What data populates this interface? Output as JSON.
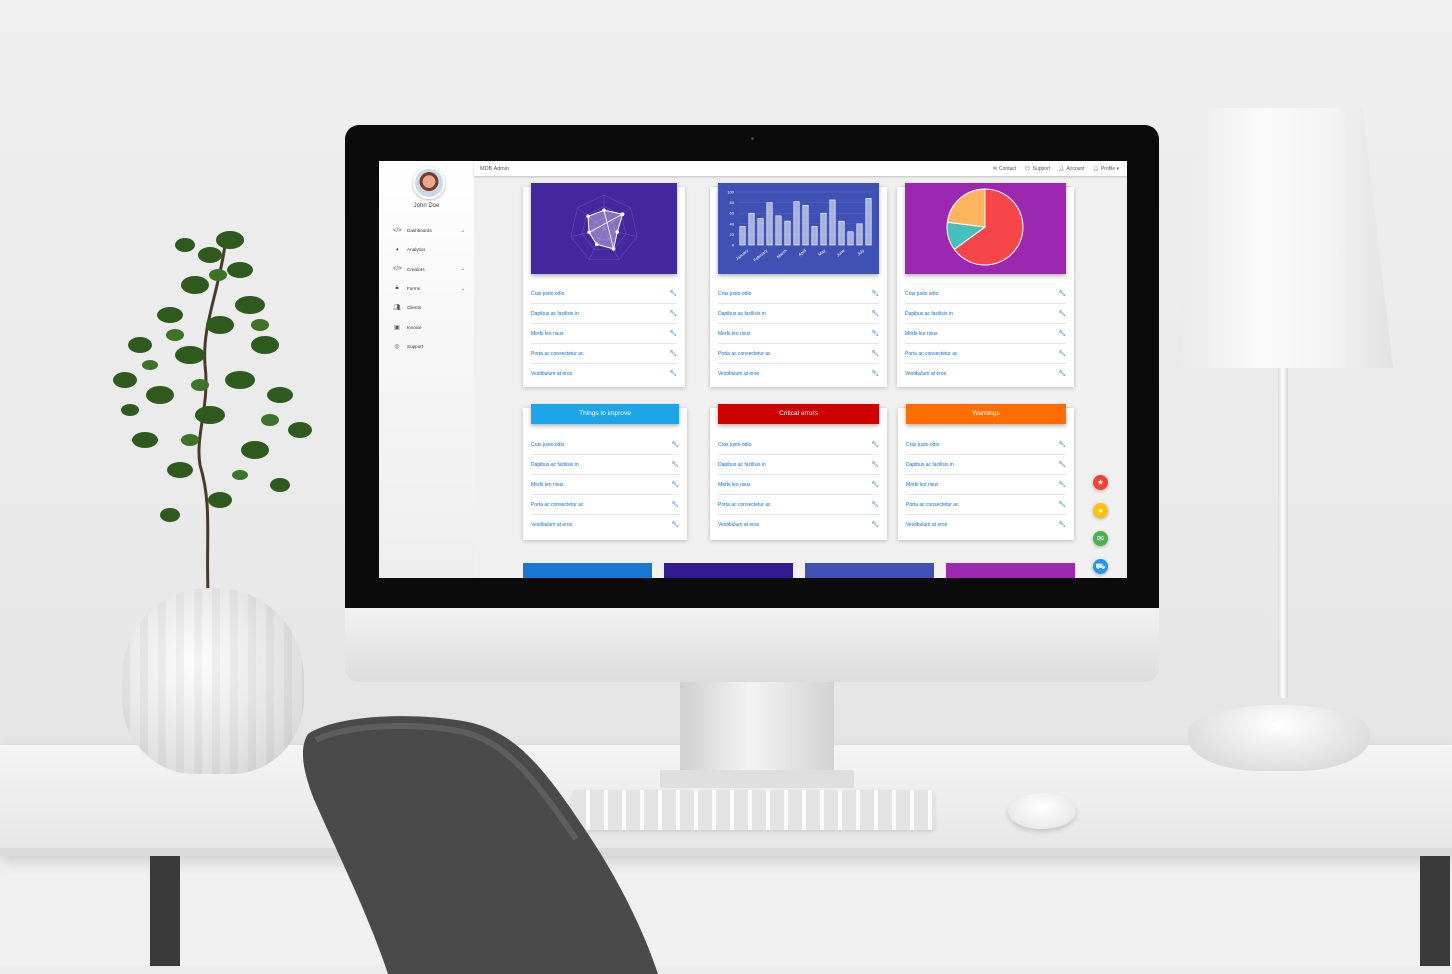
{
  "app": {
    "brand": "MDB Admin"
  },
  "user": {
    "name": "John Doe"
  },
  "sidebar": {
    "items": [
      {
        "label": "Dashboards",
        "icon": "code-icon",
        "chevron": "⌄"
      },
      {
        "label": "Analytics",
        "icon": "pie-chart-icon",
        "chevron": ""
      },
      {
        "label": "Creators",
        "icon": "code-icon",
        "chevron": "⌄"
      },
      {
        "label": "Forms",
        "icon": "lock-icon",
        "chevron": "⌄"
      },
      {
        "label": "Clients",
        "icon": "users-icon",
        "chevron": ""
      },
      {
        "label": "Invoice",
        "icon": "money-icon",
        "chevron": ""
      },
      {
        "label": "Support",
        "icon": "lifebuoy-icon",
        "chevron": ""
      }
    ]
  },
  "topbar": {
    "links": [
      {
        "label": "Contact",
        "icon": "envelope-icon"
      },
      {
        "label": "Support",
        "icon": "comments-icon"
      },
      {
        "label": "Account",
        "icon": "user-icon"
      },
      {
        "label": "Profile ▾",
        "icon": "user-icon"
      }
    ]
  },
  "list_items": [
    "Cras justo odio",
    "Dapibus ac facilisis in",
    "Morbi leo risus",
    "Porta ac consectetur ac",
    "Vestibulum at eros"
  ],
  "panels": {
    "row2": [
      {
        "title": "Things to improve",
        "color": "#1ea5e8"
      },
      {
        "title": "Critical errors",
        "color": "#cc0000"
      },
      {
        "title": "Warnings",
        "color": "#ff6d00"
      }
    ]
  },
  "colors": {
    "radar_bg": "#4527a0",
    "bar_bg": "#3f51b5",
    "pie_bg": "#9c27b0",
    "bottom": [
      "#1976d2",
      "#311b92",
      "#3f51b5",
      "#9c27b0"
    ]
  },
  "chart_data": [
    {
      "type": "radar",
      "categories": [
        "",
        "",
        "",
        "",
        "",
        "",
        ""
      ],
      "values": [
        55,
        70,
        40,
        65,
        50,
        45,
        60
      ],
      "title": ""
    },
    {
      "type": "bar",
      "categories": [
        "January",
        "February",
        "March",
        "April",
        "May",
        "June",
        "July"
      ],
      "series": [
        {
          "values": [
            35,
            60,
            50,
            80,
            55,
            45,
            82,
            75,
            35,
            60,
            85,
            45,
            25,
            40,
            88
          ]
        }
      ],
      "ylim": [
        0,
        100
      ],
      "yticks": [
        "100",
        "80",
        "60",
        "40",
        "20",
        "0"
      ]
    },
    {
      "type": "pie",
      "values": [
        65,
        12,
        23
      ],
      "colors": [
        "#f7464a",
        "#46bfbd",
        "#fdb45c"
      ]
    }
  ],
  "fabs": [
    {
      "icon": "star-icon",
      "color": "#f44336",
      "glyph": "★"
    },
    {
      "icon": "bell-icon",
      "color": "#ffc107",
      "glyph": "●"
    },
    {
      "icon": "envelope-icon",
      "color": "#4caf50",
      "glyph": "✉"
    },
    {
      "icon": "cart-icon",
      "color": "#2196f3",
      "glyph": "⛟"
    }
  ]
}
